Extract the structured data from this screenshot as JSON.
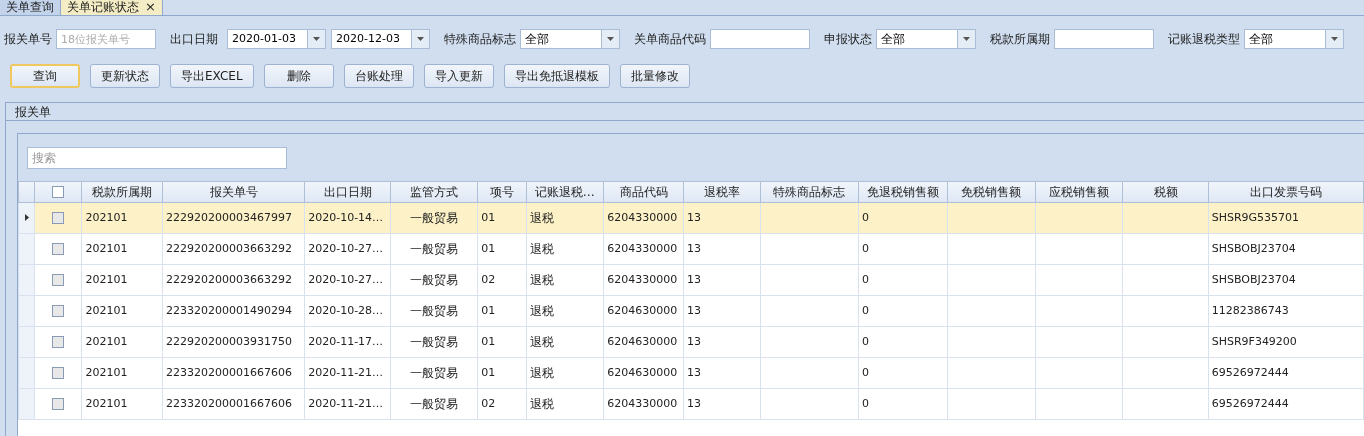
{
  "tabs": [
    {
      "label": "关单查询",
      "selected": false
    },
    {
      "label": "关单记账状态",
      "selected": true,
      "close_glyph": "×"
    }
  ],
  "filters": [
    {
      "kind": "text",
      "label": "报关单号",
      "placeholder": "18位报关单号"
    },
    {
      "kind": "daterange",
      "label": "出口日期",
      "values": [
        "2020-01-03",
        "2020-12-03"
      ]
    },
    {
      "kind": "combo",
      "label": "特殊商品标志",
      "value": "全部"
    },
    {
      "kind": "text",
      "label": "关单商品代码"
    },
    {
      "kind": "combo",
      "label": "申报状态",
      "value": "全部"
    },
    {
      "kind": "text",
      "label": "税款所属期"
    },
    {
      "kind": "combo",
      "label": "记账退税类型",
      "value": "全部"
    }
  ],
  "buttons": [
    {
      "label": "查询",
      "focused": true
    },
    {
      "label": "更新状态",
      "focused": false
    },
    {
      "label": "导出EXCEL",
      "focused": false
    },
    {
      "label": "删除",
      "focused": false
    },
    {
      "label": "台账处理",
      "focused": false
    },
    {
      "label": "导入更新",
      "focused": false
    },
    {
      "label": "导出免抵退模板",
      "focused": false
    },
    {
      "label": "批量修改",
      "focused": false
    }
  ],
  "panel": {
    "title": "报关单",
    "search": {
      "placeholder": "搜索"
    },
    "table": {
      "select_all_checked": false,
      "columns": [
        "税款所属期",
        "报关单号",
        "出口日期",
        "监管方式",
        "项号",
        "记账退税…",
        "商品代码",
        "退税率",
        "特殊商品标志",
        "免退税销售额",
        "免税销售额",
        "应税销售额",
        "税额",
        "出口发票号码"
      ],
      "rows": [
        {
          "selected": true,
          "checked": false,
          "cells": [
            "202101",
            "222920200003467997",
            "2020-10-14…",
            "一般贸易",
            "01",
            "退税",
            "6204330000",
            "13",
            "",
            "0",
            "",
            "",
            "",
            "SHSR9G535701"
          ]
        },
        {
          "selected": false,
          "checked": false,
          "cells": [
            "202101",
            "222920200003663292",
            "2020-10-27…",
            "一般贸易",
            "01",
            "退税",
            "6204330000",
            "13",
            "",
            "0",
            "",
            "",
            "",
            "SHSBOBJ23704"
          ]
        },
        {
          "selected": false,
          "checked": false,
          "cells": [
            "202101",
            "222920200003663292",
            "2020-10-27…",
            "一般贸易",
            "02",
            "退税",
            "6204330000",
            "13",
            "",
            "0",
            "",
            "",
            "",
            "SHSBOBJ23704"
          ]
        },
        {
          "selected": false,
          "checked": false,
          "cells": [
            "202101",
            "223320200001490294",
            "2020-10-28…",
            "一般贸易",
            "01",
            "退税",
            "6204630000",
            "13",
            "",
            "0",
            "",
            "",
            "",
            "11282386743"
          ]
        },
        {
          "selected": false,
          "checked": false,
          "cells": [
            "202101",
            "222920200003931750",
            "2020-11-17…",
            "一般贸易",
            "01",
            "退税",
            "6204630000",
            "13",
            "",
            "0",
            "",
            "",
            "",
            "SHSR9F349200"
          ]
        },
        {
          "selected": false,
          "checked": false,
          "cells": [
            "202101",
            "223320200001667606",
            "2020-11-21…",
            "一般贸易",
            "01",
            "退税",
            "6204630000",
            "13",
            "",
            "0",
            "",
            "",
            "",
            "69526972444"
          ]
        },
        {
          "selected": false,
          "checked": false,
          "cells": [
            "202101",
            "223320200001667606",
            "2020-11-21…",
            "一般贸易",
            "02",
            "退税",
            "6204330000",
            "13",
            "",
            "0",
            "",
            "",
            "",
            "69526972444"
          ]
        }
      ]
    }
  }
}
